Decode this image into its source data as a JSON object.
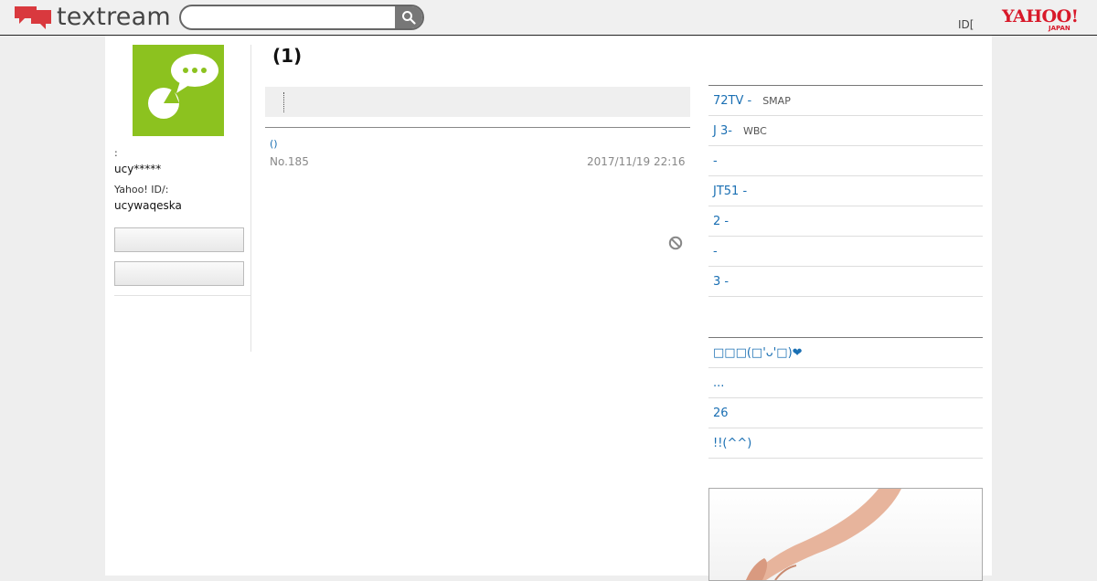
{
  "header": {
    "logo_text": "textream",
    "search": {
      "placeholder": "",
      "value": ""
    },
    "id_link": "ID[",
    "yahoo": {
      "wordmark": "YAHOO!",
      "sub": "JAPAN"
    }
  },
  "profile": {
    "label_nickname": ":",
    "nickname": "ucy*****",
    "label_yahoo_id": "Yahoo! ID/:",
    "yahoo_id": "ucywaqeska",
    "button1": "",
    "button2": ""
  },
  "main": {
    "title": "(1)",
    "post": {
      "link": "()",
      "number": "No.185",
      "date": "2017/11/19 22:16"
    }
  },
  "sidebar": {
    "list1": [
      {
        "title": "72TV -",
        "sub": "SMAP"
      },
      {
        "title": "J 3-",
        "sub": "WBC"
      },
      {
        "title": "-",
        "sub": ""
      },
      {
        "title": "JT51 -",
        "sub": ""
      },
      {
        "title": "2 -",
        "sub": ""
      },
      {
        "title": "-",
        "sub": ""
      },
      {
        "title": "3 -",
        "sub": ""
      }
    ],
    "list2": [
      {
        "title": "□□□(□'ᴗ'□)❤"
      },
      {
        "title": "..."
      },
      {
        "title": "26"
      },
      {
        "title": "!!(^^)"
      }
    ]
  },
  "colors": {
    "accent_link": "#1a6fb3",
    "logo_red": "#d9393e",
    "avatar_green": "#8cc21f",
    "yahoo_red": "#d8192a"
  }
}
